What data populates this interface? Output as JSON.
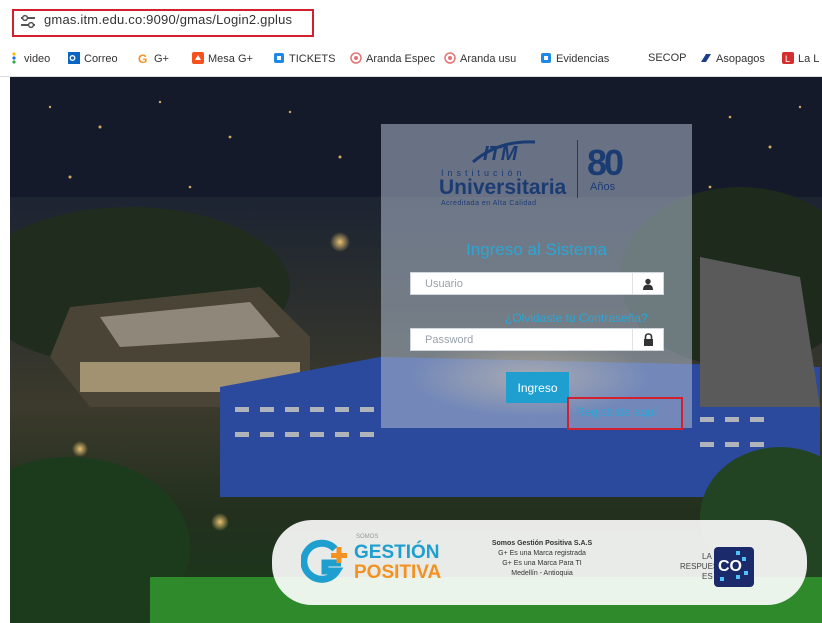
{
  "browser": {
    "url": "gmas.itm.edu.co:9090/gmas/Login2.gplus",
    "bookmarks": [
      {
        "label": "video",
        "icon": "dots-icon",
        "color": "#1a73e8"
      },
      {
        "label": "Correo",
        "icon": "outlook-icon",
        "color": "#0a66c2"
      },
      {
        "label": "G+",
        "icon": "gplus-icon",
        "color": "#f39220"
      },
      {
        "label": "Mesa G+",
        "icon": "mesa-icon",
        "color": "#f4511e"
      },
      {
        "label": "TICKETS",
        "icon": "ticket-icon",
        "color": "#1e88e5"
      },
      {
        "label": "Aranda Espec",
        "icon": "aranda-icon",
        "color": "#e57373"
      },
      {
        "label": "Aranda usu",
        "icon": "aranda-icon",
        "color": "#e57373"
      },
      {
        "label": "Evidencias",
        "icon": "evidence-icon",
        "color": "#1e88e5"
      },
      {
        "label": "SECOP",
        "icon": "",
        "color": ""
      },
      {
        "label": "Asopagos",
        "icon": "asopagos-icon",
        "color": "#1a3e8a"
      },
      {
        "label": "La L",
        "icon": "lal-icon",
        "color": "#d32f2f"
      }
    ]
  },
  "login": {
    "logo": {
      "brand": "ITM",
      "institucion": "Institución",
      "universitaria": "Universitaria",
      "acreditada": "Acreditada en Alta Calidad",
      "anniversary_number": "80",
      "anniversary_word": "Años"
    },
    "title": "Ingreso al Sistema",
    "username_placeholder": "Usuario",
    "password_placeholder": "Password",
    "forgot_link": "¿Olvidaste tu Contraseña?",
    "submit_label": "Ingreso",
    "register_link": "Registrate aquí"
  },
  "footer": {
    "gp_small": "SOMOS",
    "gp_word1": "GESTIÓN",
    "gp_word2": "POSITIVA",
    "company_name": "Somos Gestión Positiva S.A.S",
    "line1": "G+ Es una Marca registrada",
    "line2": "G+ Es una Marca Para TI",
    "line3": "Medellín - Antioquia",
    "respuesta_la": "LA",
    "respuesta_word": "RESPUESTA",
    "respuesta_es": "ES",
    "co_text": "CO"
  },
  "colors": {
    "accent": "#2aa7d6",
    "button": "#1e9fd0",
    "highlight": "#d2202f",
    "navy": "#1b3b73",
    "orange": "#f39220"
  }
}
